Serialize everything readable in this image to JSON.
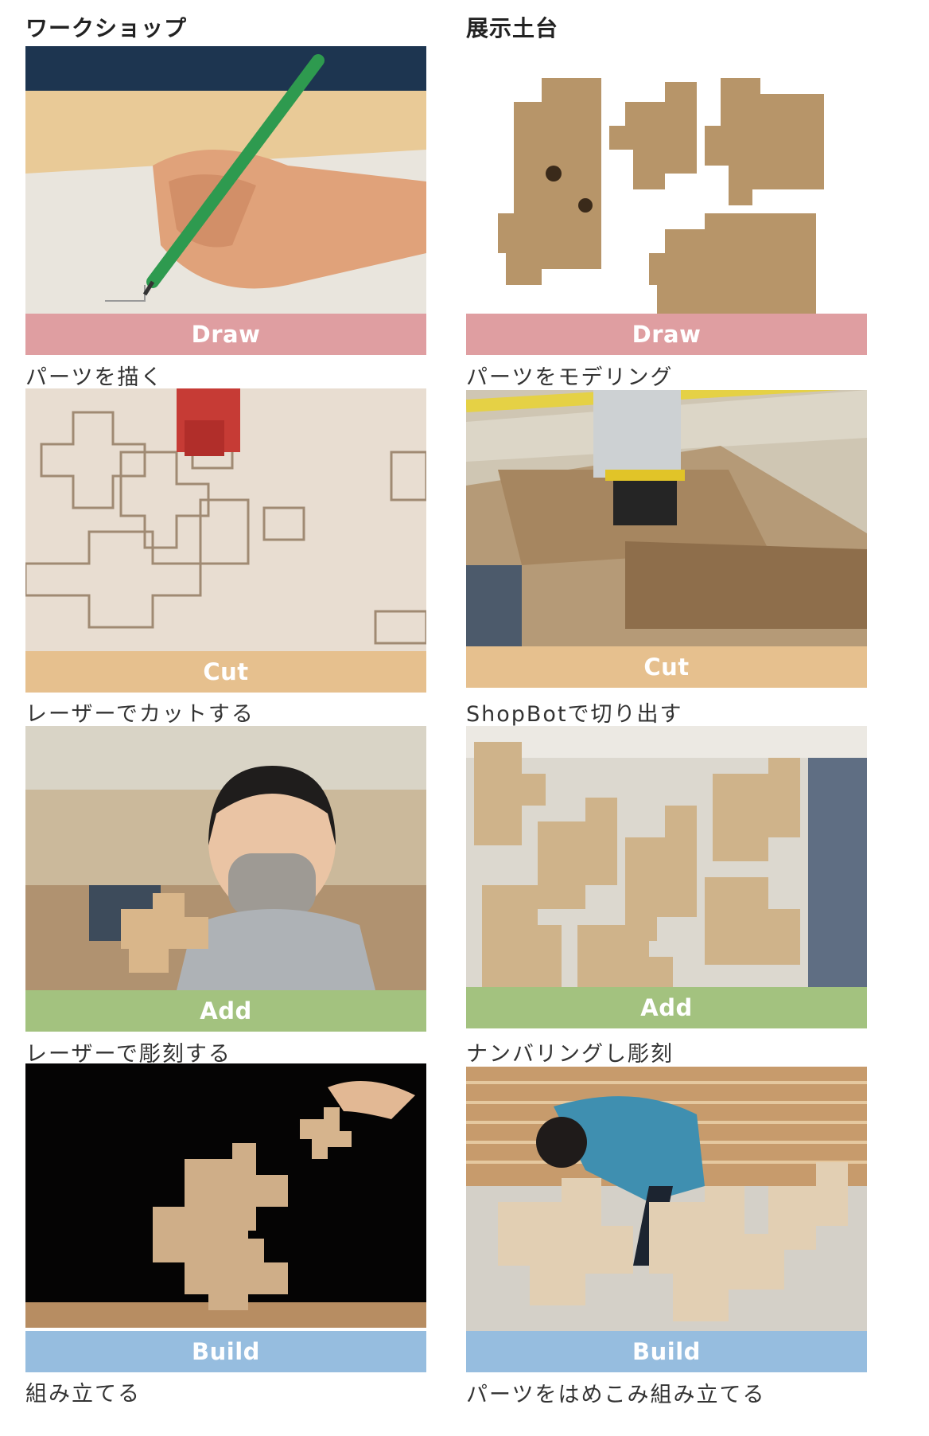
{
  "colors": {
    "draw": "#df9ea1",
    "cut": "#e6c08e",
    "add": "#a3c27f",
    "build": "#96bddf"
  },
  "left": {
    "title": "ワークショップ",
    "steps": [
      {
        "label": "Draw",
        "caption": "パーツを描く",
        "image": "hand-drawing-with-green-pencil"
      },
      {
        "label": "Cut",
        "caption": "レーザーでカットする",
        "image": "laser-cutter-on-board"
      },
      {
        "label": "Add",
        "caption": "レーザーで彫刻する",
        "image": "person-with-mask-holding-piece"
      },
      {
        "label": "Build",
        "caption": "組み立てる",
        "image": "assembled-wooden-pieces"
      }
    ]
  },
  "right": {
    "title": "展示土台",
    "steps": [
      {
        "label": "Draw",
        "caption": "パーツをモデリング",
        "image": "modeled-wood-parts"
      },
      {
        "label": "Cut",
        "caption": "ShopBotで切り出す",
        "image": "shopbot-cnc-router"
      },
      {
        "label": "Add",
        "caption": "ナンバリングし彫刻",
        "image": "stacked-wooden-parts"
      },
      {
        "label": "Build",
        "caption": "パーツをはめこみ組み立てる",
        "image": "person-assembling-structure"
      }
    ]
  }
}
